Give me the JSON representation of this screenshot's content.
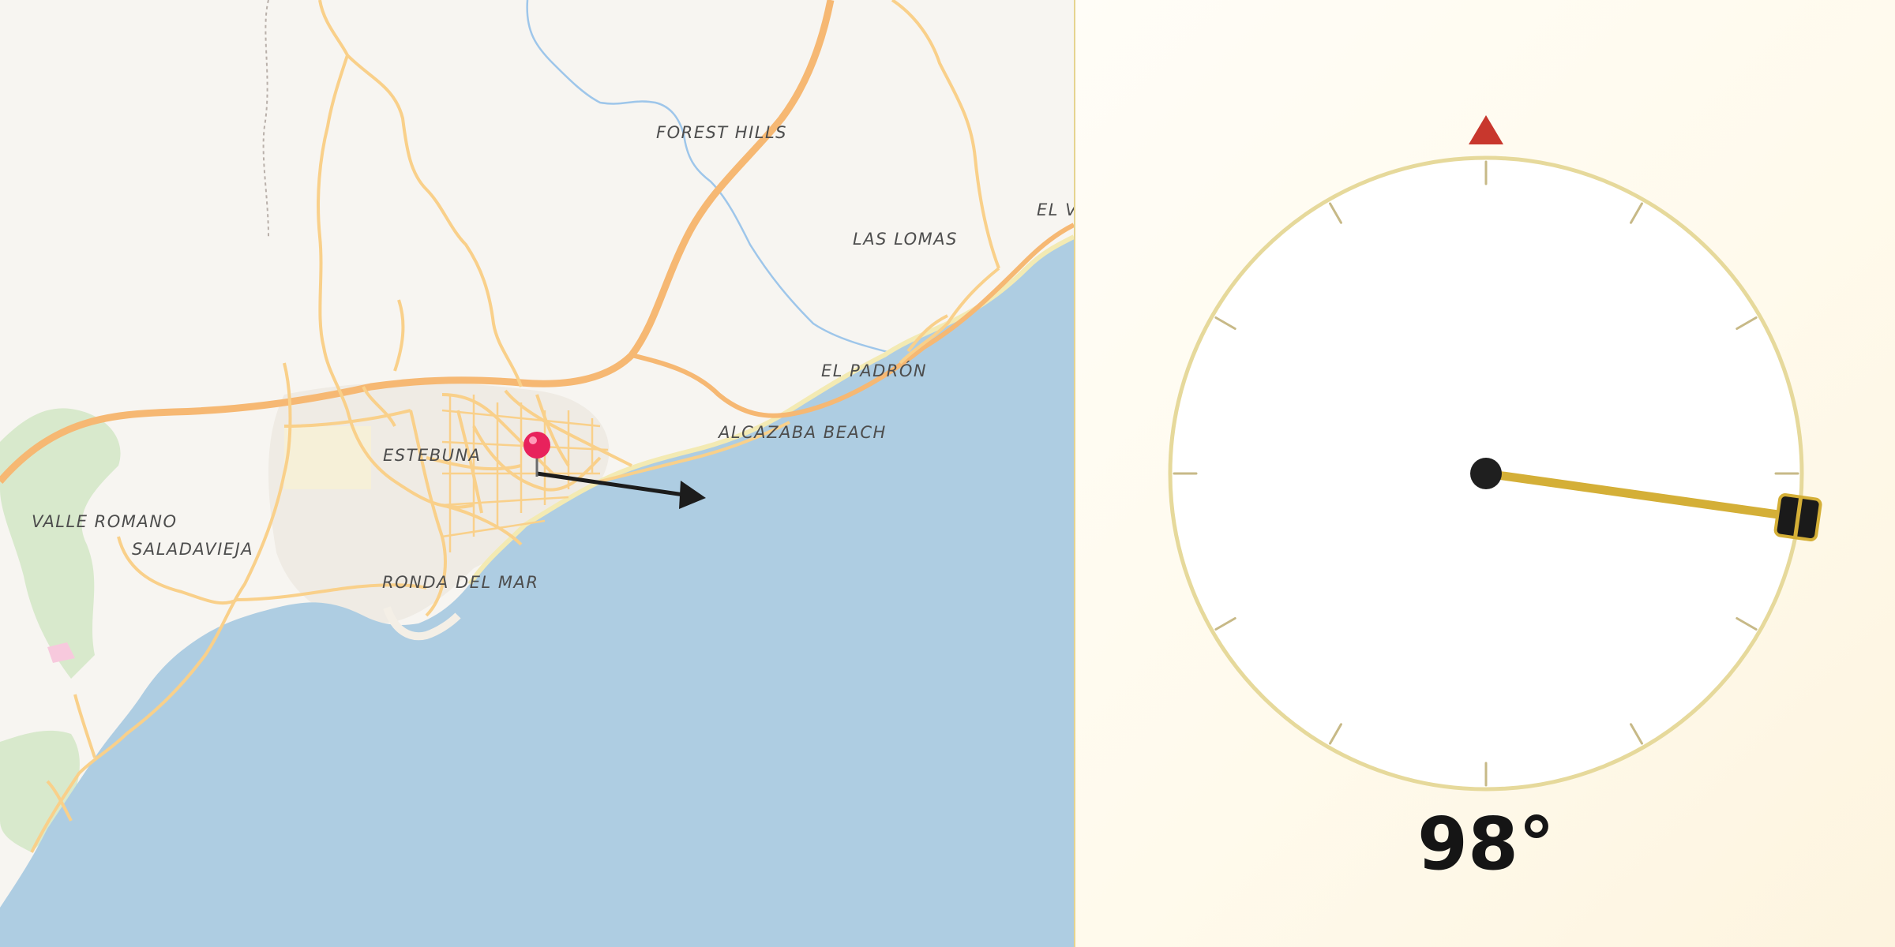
{
  "map": {
    "places": {
      "forest_hills": "FOREST HILLS",
      "las_lomas": "LAS LOMAS",
      "el_vi": "EL VI",
      "el_padron": "EL PADRÓN",
      "alcazaba_beach": "ALCAZABA BEACH",
      "estebuna": "ESTEBUNA",
      "valle_romano": "VALLE ROMANO",
      "saladavieja": "SALADAVIEJA",
      "ronda_del_mar": "RONDA DEL MAR"
    },
    "marker": {
      "type": "pin",
      "color": "#e8225c"
    },
    "direction_arrow": {
      "bearing_deg": 98,
      "color": "#1c1c1c"
    },
    "colors": {
      "sea": "#aecde2",
      "land": "#f7f5f1",
      "road": "#f9cf84",
      "highway": "#f6b873",
      "river": "#8fbfe8",
      "park": "#d5e8c8"
    }
  },
  "compass": {
    "bearing_deg": 98,
    "readout": "98°",
    "north_marker_color": "#c8372d",
    "needle_color": "#d4af37",
    "ring_color": "#e6d99b",
    "handle_icon": "drag-handle-icon"
  }
}
